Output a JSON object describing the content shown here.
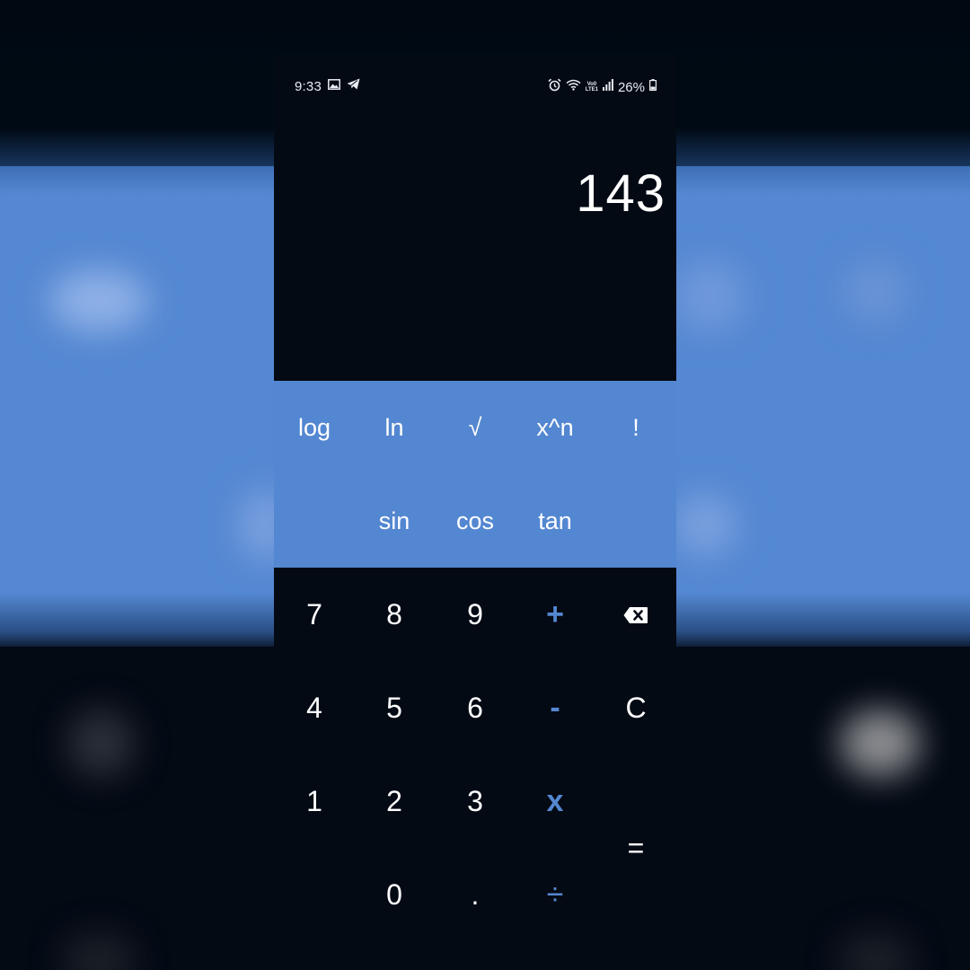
{
  "status_bar": {
    "time": "9:33",
    "battery": "26%",
    "network_top": "Vo0",
    "network_bottom": "LTE1",
    "icons": [
      "gallery-icon",
      "telegram-icon",
      "alarm-icon",
      "wifi-icon",
      "signal-icon",
      "battery-icon"
    ]
  },
  "display": {
    "result": "143"
  },
  "scientific": {
    "row1": [
      "log",
      "ln",
      "√",
      "x^n",
      "!"
    ],
    "row2": [
      "sin",
      "cos",
      "tan"
    ]
  },
  "keypad": {
    "row1": [
      "7",
      "8",
      "9",
      "+"
    ],
    "row2": [
      "4",
      "5",
      "6",
      "-",
      "C"
    ],
    "row3": [
      "1",
      "2",
      "3",
      "x"
    ],
    "row4": [
      "0",
      ".",
      "÷"
    ],
    "equals": "=",
    "backspace": "backspace-icon"
  },
  "colors": {
    "accent": "#5487d1",
    "background": "#040a14",
    "text": "#ffffff"
  }
}
